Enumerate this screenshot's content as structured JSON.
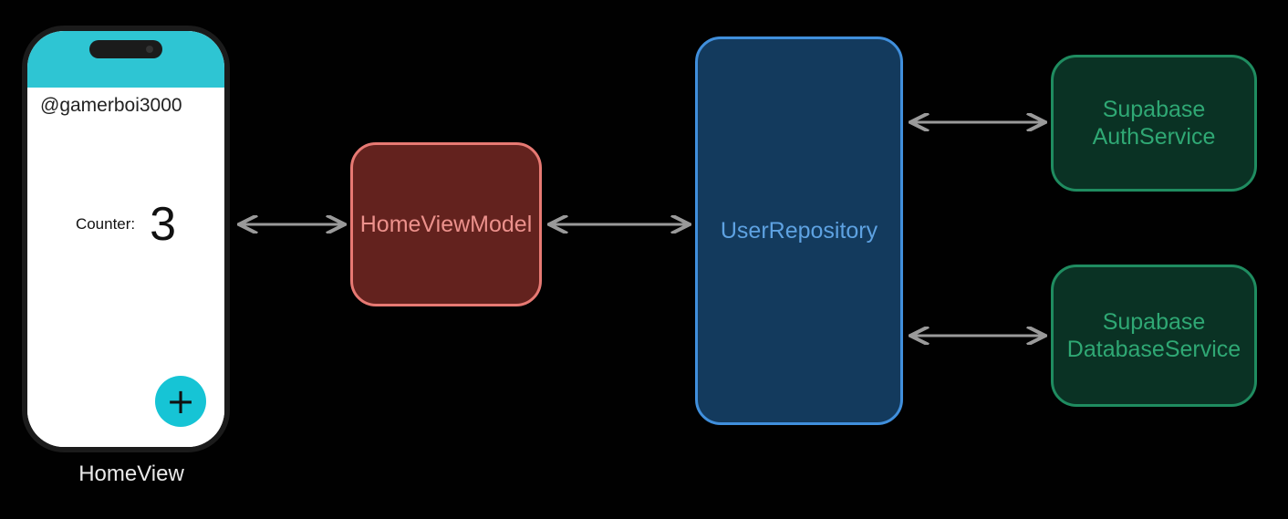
{
  "phone": {
    "username": "@gamerboi3000",
    "counter_label": "Counter:",
    "counter_value": "3",
    "fab_label": "+",
    "caption": "HomeView"
  },
  "nodes": {
    "view_model": {
      "label": "HomeViewModel"
    },
    "repository": {
      "label": "UserRepository"
    },
    "auth_service": {
      "label": "Supabase\nAuthService"
    },
    "db_service": {
      "label": "Supabase\nDatabaseService"
    }
  }
}
